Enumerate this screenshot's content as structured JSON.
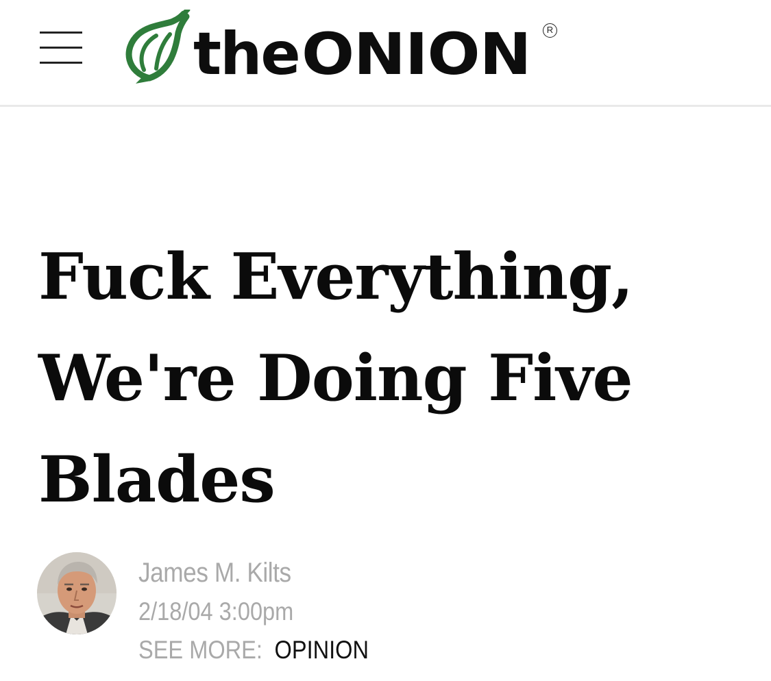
{
  "header": {
    "logo": {
      "word_the": "the",
      "word_onion": "ONION",
      "registered_mark": "R",
      "icon": "onion-icon",
      "icon_color": "#2f7d3b"
    },
    "menu_icon": "hamburger-menu-icon"
  },
  "article": {
    "headline": "Fuck Everything, We're Doing Five Blades",
    "author": {
      "name": "James M. Kilts",
      "avatar": "author-avatar"
    },
    "date": "2/18/04 3:00pm",
    "see_more": {
      "label": "SEE MORE:",
      "link": "OPINION"
    }
  },
  "colors": {
    "text_primary": "#0b0b0b",
    "text_muted": "#a9a9a9",
    "divider": "#e9e9e9",
    "brand_green": "#2f7d3b"
  }
}
